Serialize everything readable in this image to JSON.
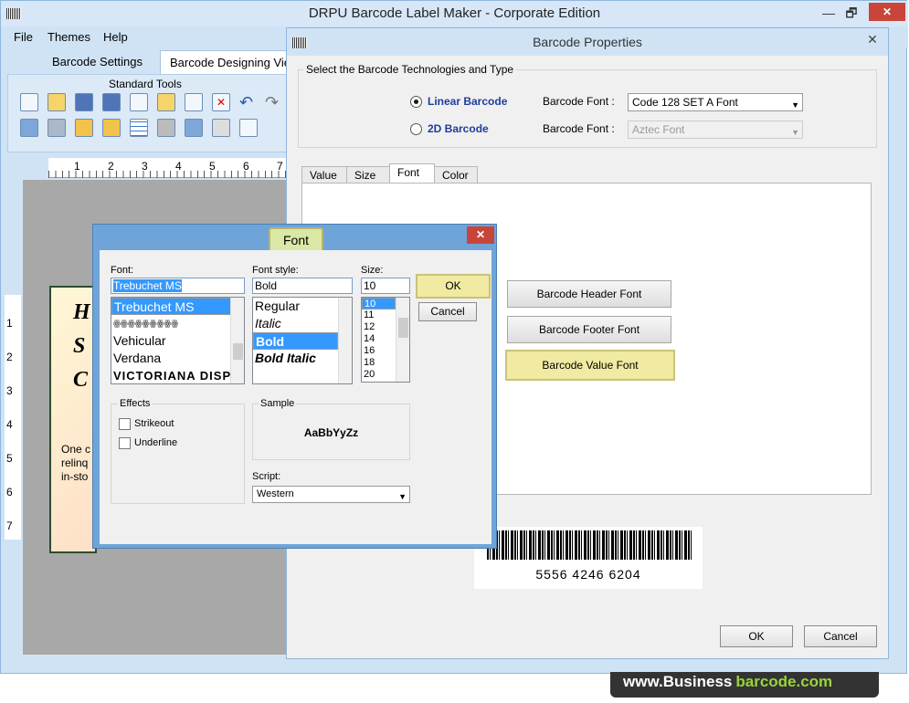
{
  "app": {
    "title": "DRPU Barcode Label Maker - Corporate Edition",
    "restore": "🗗",
    "minimize": "—",
    "close": "✕"
  },
  "menu": [
    "File",
    "Themes",
    "Help"
  ],
  "main_tabs": [
    "Barcode Settings",
    "Barcode Designing View"
  ],
  "toolbar": {
    "title": "Standard Tools"
  },
  "ruler_h": [
    "1",
    "2",
    "3",
    "4",
    "5",
    "6",
    "7"
  ],
  "ruler_v": [
    "1",
    "2",
    "3",
    "4",
    "5",
    "6",
    "7"
  ],
  "label_text": {
    "line1": "H",
    "line2": "S",
    "line3": "C",
    "body1": "One c",
    "body2": "relinq",
    "body3": "in-sto"
  },
  "barcode_properties": {
    "title": "Barcode Properties",
    "close": "✕",
    "group_title": "Select the Barcode Technologies and Type",
    "linear": {
      "label": "Linear Barcode",
      "selected": true,
      "font_label": "Barcode Font :",
      "font_value": "Code 128 SET A Font"
    },
    "twod": {
      "label": "2D Barcode",
      "selected": false,
      "font_label": "Barcode Font :",
      "font_value": "Aztec Font"
    },
    "tabs": [
      "Value",
      "Size",
      "Font",
      "Color"
    ],
    "active_tab": "Font",
    "font_buttons": [
      "Barcode Header Font",
      "Barcode Footer Font",
      "Barcode Value Font"
    ],
    "barcode_value": "5556 4246 6204",
    "ok": "OK",
    "cancel": "Cancel"
  },
  "font_dialog": {
    "title": "Font",
    "close": "✕",
    "font_label": "Font:",
    "font_value": "Trebuchet MS",
    "fonts": [
      "Trebuchet MS",
      "ꙮꙮꙮꙮꙮꙮꙮꙮꙮ",
      "Vehicular",
      "Verdana",
      "VICTORIANA DISP"
    ],
    "style_label": "Font style:",
    "style_value": "Bold",
    "styles": [
      "Regular",
      "Italic",
      "Bold",
      "Bold Italic"
    ],
    "size_label": "Size:",
    "size_value": "10",
    "sizes": [
      "10",
      "11",
      "12",
      "14",
      "16",
      "18",
      "20"
    ],
    "ok": "OK",
    "cancel": "Cancel",
    "effects_label": "Effects",
    "strikeout": "Strikeout",
    "underline": "Underline",
    "sample_label": "Sample",
    "sample_text": "AaBbYyZz",
    "script_label": "Script:",
    "script_value": "Western"
  },
  "brand": {
    "part1": "www.",
    "part2": "Business",
    "part3": "barcode.com"
  }
}
